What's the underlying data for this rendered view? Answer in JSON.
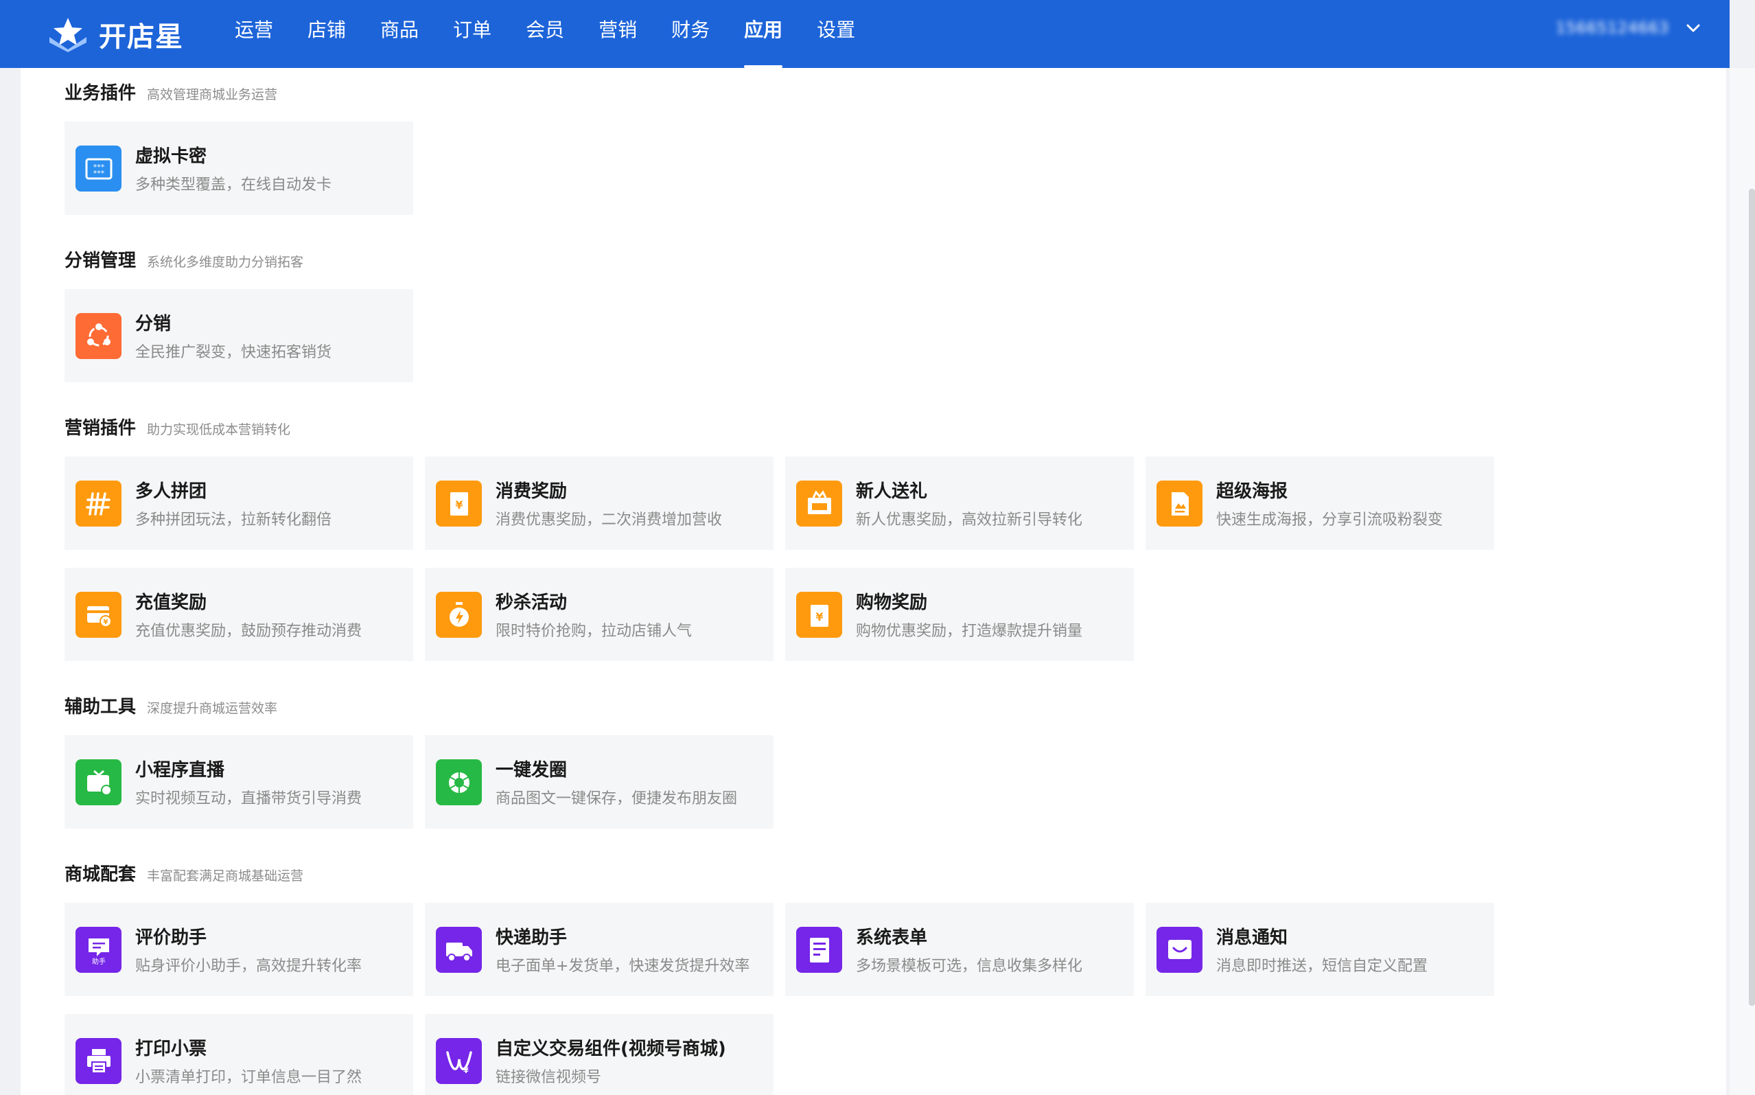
{
  "header": {
    "brand": "开店星",
    "nav": [
      {
        "label": "运营"
      },
      {
        "label": "店铺"
      },
      {
        "label": "商品"
      },
      {
        "label": "订单"
      },
      {
        "label": "会员"
      },
      {
        "label": "营销"
      },
      {
        "label": "财务"
      },
      {
        "label": "应用",
        "active": true
      },
      {
        "label": "设置"
      }
    ],
    "user_id": "15665124663"
  },
  "sections": [
    {
      "title": "业务插件",
      "subtitle": "高效管理商城业务运营",
      "cards": [
        {
          "title": "虚拟卡密",
          "desc": "多种类型覆盖，在线自动发卡",
          "color": "#2a8ff0",
          "icon": "card-password-icon"
        }
      ]
    },
    {
      "title": "分销管理",
      "subtitle": "系统化多维度助力分销拓客",
      "cards": [
        {
          "title": "分销",
          "desc": "全民推广裂变，快速拓客销货",
          "color": "#ff6b35",
          "icon": "distribution-icon"
        }
      ]
    },
    {
      "title": "营销插件",
      "subtitle": "助力实现低成本营销转化",
      "cards": [
        {
          "title": "多人拼团",
          "desc": "多种拼团玩法，拉新转化翻倍",
          "color": "#ff9a0e",
          "icon": "group-buy-icon"
        },
        {
          "title": "消费奖励",
          "desc": "消费优惠奖励，二次消费增加营收",
          "color": "#ff9a0e",
          "icon": "consume-reward-icon"
        },
        {
          "title": "新人送礼",
          "desc": "新人优惠奖励，高效拉新引导转化",
          "color": "#ff9a0e",
          "icon": "new-gift-icon"
        },
        {
          "title": "超级海报",
          "desc": "快速生成海报，分享引流吸粉裂变",
          "color": "#ff9a0e",
          "icon": "poster-icon"
        },
        {
          "title": "充值奖励",
          "desc": "充值优惠奖励，鼓励预存推动消费",
          "color": "#ff9a0e",
          "icon": "recharge-reward-icon"
        },
        {
          "title": "秒杀活动",
          "desc": "限时特价抢购，拉动店铺人气",
          "color": "#ff9a0e",
          "icon": "seckill-icon"
        },
        {
          "title": "购物奖励",
          "desc": "购物优惠奖励，打造爆款提升销量",
          "color": "#ff9a0e",
          "icon": "shopping-reward-icon"
        }
      ]
    },
    {
      "title": "辅助工具",
      "subtitle": "深度提升商城运营效率",
      "cards": [
        {
          "title": "小程序直播",
          "desc": "实时视频互动，直播带货引导消费",
          "color": "#27b945",
          "icon": "live-broadcast-icon"
        },
        {
          "title": "一键发圈",
          "desc": "商品图文一键保存，便捷发布朋友圈",
          "color": "#27b945",
          "icon": "moments-share-icon"
        }
      ]
    },
    {
      "title": "商城配套",
      "subtitle": "丰富配套满足商城基础运营",
      "cards": [
        {
          "title": "评价助手",
          "desc": "贴身评价小助手，高效提升转化率",
          "color": "#7526e8",
          "icon": "review-assistant-icon",
          "badge": "助手"
        },
        {
          "title": "快递助手",
          "desc": "电子面单+发货单，快速发货提升效率",
          "color": "#7526e8",
          "icon": "express-truck-icon"
        },
        {
          "title": "系统表单",
          "desc": "多场景模板可选，信息收集多样化",
          "color": "#7526e8",
          "icon": "system-form-icon"
        },
        {
          "title": "消息通知",
          "desc": "消息即时推送，短信自定义配置",
          "color": "#7526e8",
          "icon": "message-notify-icon"
        },
        {
          "title": "打印小票",
          "desc": "小票清单打印，订单信息一目了然",
          "color": "#7526e8",
          "icon": "print-receipt-icon"
        },
        {
          "title": "自定义交易组件(视频号商城)",
          "desc": "链接微信视频号",
          "color": "#7526e8",
          "icon": "video-channel-icon"
        }
      ]
    }
  ]
}
